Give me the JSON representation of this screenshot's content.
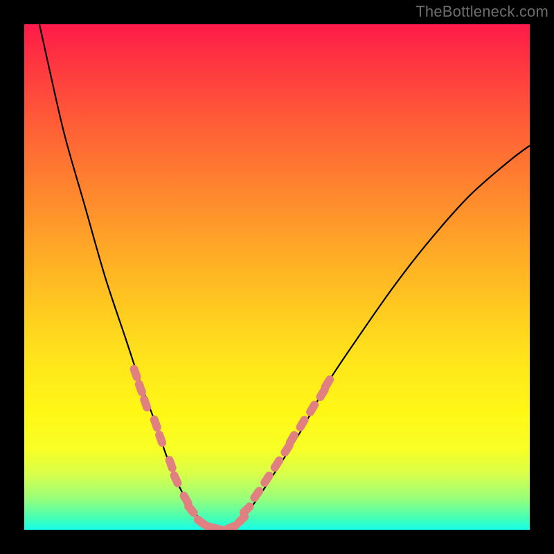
{
  "watermark": "TheBottleneck.com",
  "chart_data": {
    "type": "line",
    "title": "",
    "xlabel": "",
    "ylabel": "",
    "xlim": [
      0,
      100
    ],
    "ylim": [
      0,
      100
    ],
    "series": [
      {
        "name": "bottleneck-curve",
        "x": [
          3,
          5,
          8,
          12,
          16,
          20,
          23,
          26,
          28,
          30,
          32,
          34,
          36,
          38,
          40,
          43,
          46,
          50,
          55,
          60,
          66,
          73,
          80,
          88,
          96,
          100
        ],
        "y": [
          100,
          91,
          78,
          64,
          50,
          38,
          29,
          21,
          15,
          10,
          6,
          3,
          1,
          0,
          0,
          2,
          6,
          12,
          20,
          29,
          38,
          48,
          57,
          66,
          73,
          76
        ],
        "color": "#000000"
      }
    ],
    "markers": {
      "name": "fit-region",
      "color": "#e08080",
      "points": [
        {
          "x": 22,
          "y": 31
        },
        {
          "x": 23,
          "y": 28
        },
        {
          "x": 24,
          "y": 25
        },
        {
          "x": 26,
          "y": 21
        },
        {
          "x": 27,
          "y": 18
        },
        {
          "x": 29,
          "y": 13
        },
        {
          "x": 30,
          "y": 10
        },
        {
          "x": 32,
          "y": 6
        },
        {
          "x": 33,
          "y": 4
        },
        {
          "x": 35,
          "y": 1.5
        },
        {
          "x": 37,
          "y": 0.5
        },
        {
          "x": 39,
          "y": 0
        },
        {
          "x": 41,
          "y": 0.5
        },
        {
          "x": 43,
          "y": 2
        },
        {
          "x": 44,
          "y": 4
        },
        {
          "x": 46,
          "y": 7
        },
        {
          "x": 48,
          "y": 10
        },
        {
          "x": 50,
          "y": 13
        },
        {
          "x": 52,
          "y": 16
        },
        {
          "x": 53,
          "y": 18
        },
        {
          "x": 55,
          "y": 21
        },
        {
          "x": 57,
          "y": 24
        },
        {
          "x": 59,
          "y": 27
        },
        {
          "x": 60,
          "y": 29
        }
      ]
    },
    "gradient_stops": [
      {
        "pos": 0,
        "color": "#fe1a49"
      },
      {
        "pos": 50,
        "color": "#ffb324"
      },
      {
        "pos": 80,
        "color": "#fff816"
      },
      {
        "pos": 100,
        "color": "#17ffea"
      }
    ]
  }
}
